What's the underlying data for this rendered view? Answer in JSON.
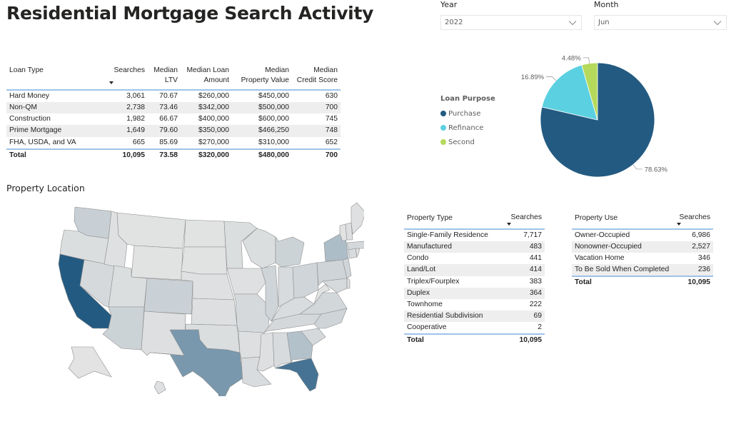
{
  "page": {
    "title": "Residential Mortgage Search Activity"
  },
  "filters": {
    "year": {
      "label": "Year",
      "value": "2022"
    },
    "month": {
      "label": "Month",
      "value": "Jun"
    }
  },
  "loan_table": {
    "headers": {
      "loan_type": "Loan Type",
      "searches": "Searches",
      "median_ltv_1": "Median",
      "median_ltv_2": "LTV",
      "median_loan_1": "Median Loan",
      "median_loan_2": "Amount",
      "median_prop_1": "Median",
      "median_prop_2": "Property Value",
      "median_credit_1": "Median",
      "median_credit_2": "Credit Score"
    },
    "rows": [
      {
        "loan_type": "Hard Money",
        "searches": "3,061",
        "ltv": "70.67",
        "loan_amount": "$260,000",
        "property_value": "$450,000",
        "credit_score": "630"
      },
      {
        "loan_type": "Non-QM",
        "searches": "2,738",
        "ltv": "73.46",
        "loan_amount": "$342,000",
        "property_value": "$500,000",
        "credit_score": "700"
      },
      {
        "loan_type": "Construction",
        "searches": "1,982",
        "ltv": "66.67",
        "loan_amount": "$400,000",
        "property_value": "$600,000",
        "credit_score": "745"
      },
      {
        "loan_type": "Prime Mortgage",
        "searches": "1,649",
        "ltv": "79.60",
        "loan_amount": "$350,000",
        "property_value": "$466,250",
        "credit_score": "748"
      },
      {
        "loan_type": "FHA, USDA, and VA",
        "searches": "665",
        "ltv": "85.69",
        "loan_amount": "$270,000",
        "property_value": "$310,000",
        "credit_score": "652"
      }
    ],
    "total": {
      "loan_type": "Total",
      "searches": "10,095",
      "ltv": "73.58",
      "loan_amount": "$320,000",
      "property_value": "$480,000",
      "credit_score": "700"
    }
  },
  "loan_purpose": {
    "legend_title": "Loan Purpose",
    "slices": [
      {
        "name": "Purchase",
        "percent": 78.63,
        "label": "78.63%",
        "color": "#235a81"
      },
      {
        "name": "Refinance",
        "percent": 16.89,
        "label": "16.89%",
        "color": "#5bd0e0"
      },
      {
        "name": "Second",
        "percent": 4.48,
        "label": "4.48%",
        "color": "#b5d95a"
      }
    ]
  },
  "property_location": {
    "title": "Property Location",
    "color_scale": {
      "low": "#e3e3e3",
      "high": "#235a81"
    },
    "state_intensity": {
      "CA": 1.0,
      "FL": 0.82,
      "TX": 0.55,
      "NY": 0.28,
      "GA": 0.25,
      "WA": 0.14,
      "CO": 0.13,
      "AZ": 0.12,
      "MI": 0.12,
      "IL": 0.11,
      "PA": 0.11,
      "NC": 0.11,
      "OH": 0.1,
      "NJ": 0.1,
      "VA": 0.09,
      "TN": 0.08,
      "MO": 0.07,
      "NV": 0.07,
      "MA": 0.08,
      "SC": 0.07,
      "IN": 0.06,
      "AL": 0.06,
      "MD": 0.07,
      "CT": 0.06,
      "KY": 0.05,
      "LA": 0.05,
      "OK": 0.04,
      "OR": 0.04,
      "UT": 0.04,
      "MN": 0.04,
      "WI": 0.04,
      "MS": 0.03,
      "AR": 0.03,
      "NM": 0.03,
      "KS": 0.03,
      "IA": 0.02,
      "NE": 0.02,
      "ID": 0.02,
      "MT": 0.01,
      "WY": 0.01,
      "ND": 0.01,
      "SD": 0.01,
      "WV": 0.01,
      "ME": 0.02,
      "NH": 0.03,
      "VT": 0.01,
      "RI": 0.03,
      "DE": 0.04,
      "AK": 0.0,
      "HI": 0.02
    }
  },
  "property_type_table": {
    "headers": {
      "name": "Property Type",
      "searches": "Searches"
    },
    "rows": [
      {
        "name": "Single-Family Residence",
        "searches": "7,717"
      },
      {
        "name": "Manufactured",
        "searches": "483"
      },
      {
        "name": "Condo",
        "searches": "441"
      },
      {
        "name": "Land/Lot",
        "searches": "414"
      },
      {
        "name": "Triplex/Fourplex",
        "searches": "383"
      },
      {
        "name": "Duplex",
        "searches": "364"
      },
      {
        "name": "Townhome",
        "searches": "222"
      },
      {
        "name": "Residential Subdivision",
        "searches": "69"
      },
      {
        "name": "Cooperative",
        "searches": "2"
      }
    ],
    "total": {
      "name": "Total",
      "searches": "10,095"
    }
  },
  "property_use_table": {
    "headers": {
      "name": "Property Use",
      "searches": "Searches"
    },
    "rows": [
      {
        "name": "Owner-Occupied",
        "searches": "6,986"
      },
      {
        "name": "Nonowner-Occupied",
        "searches": "2,527"
      },
      {
        "name": "Vacation Home",
        "searches": "346"
      },
      {
        "name": "To Be Sold When Completed",
        "searches": "236"
      }
    ],
    "total": {
      "name": "Total",
      "searches": "10,095"
    }
  }
}
